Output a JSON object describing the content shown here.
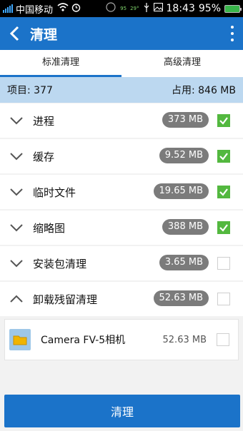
{
  "statusbar": {
    "carrier": "中国移动",
    "time": "18:43",
    "battery": "95%",
    "small_a": "95",
    "small_b": "29°"
  },
  "appbar": {
    "title": "清理"
  },
  "tabs": [
    {
      "label": "标准清理"
    },
    {
      "label": "高级清理"
    }
  ],
  "summary": {
    "items": "项目: 377",
    "used": "占用: 846 MB"
  },
  "rows": [
    {
      "name": "进程",
      "size": "373 MB",
      "checked": true
    },
    {
      "name": "缓存",
      "size": "9.52 MB",
      "checked": true
    },
    {
      "name": "临时文件",
      "size": "19.65 MB",
      "checked": true
    },
    {
      "name": "缩略图",
      "size": "388 MB",
      "checked": true
    },
    {
      "name": "安装包清理",
      "size": "3.65 MB",
      "checked": false
    },
    {
      "name": "卸载残留清理",
      "size": "52.63 MB",
      "checked": false
    }
  ],
  "subitem": {
    "name": "Camera FV-5相机",
    "size": "52.63 MB",
    "checked": false
  },
  "button": {
    "label": "清理"
  },
  "colors": {
    "accent": "#1b73c9",
    "check": "#53b83f",
    "summary_bg": "#bcd8f0"
  }
}
